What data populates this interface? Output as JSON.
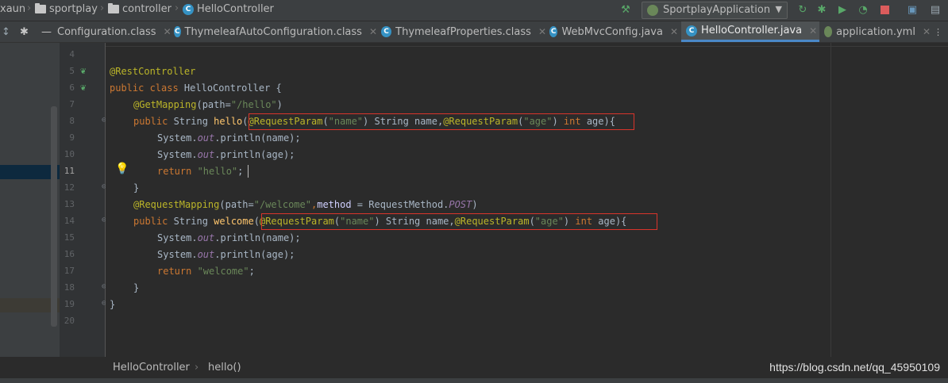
{
  "breadcrumb": {
    "items": [
      "xaun",
      "sportplay",
      "controller",
      "HelloController"
    ]
  },
  "toolbar": {
    "run_config": "SportplayApplication"
  },
  "tabs": [
    {
      "label": "Configuration.class"
    },
    {
      "label": "ThymeleafAutoConfiguration.class"
    },
    {
      "label": "ThymeleafProperties.class"
    },
    {
      "label": "WebMvcConfig.java"
    },
    {
      "label": "HelloController.java"
    },
    {
      "label": "application.yml"
    }
  ],
  "editor": {
    "line_numbers": [
      "4",
      "5",
      "6",
      "7",
      "8",
      "9",
      "10",
      "11",
      "12",
      "13",
      "14",
      "15",
      "16",
      "17",
      "18",
      "19",
      "20"
    ],
    "code": {
      "l5": "@RestController",
      "l6a": "public class ",
      "l6b": "HelloController {",
      "l7a": "@GetMapping",
      "l7b": "(path=",
      "l7c": "\"/hello\"",
      "l7d": ")",
      "l8a": "public ",
      "l8b": "String ",
      "l8c": "hello",
      "l8d": "(",
      "l8e": "@RequestParam",
      "l8f": "(",
      "l8g": "\"name\"",
      "l8h": ") String name,",
      "l8i": "@RequestParam",
      "l8j": "(",
      "l8k": "\"age\"",
      "l8l": ") ",
      "l8m": "int ",
      "l8n": "age){",
      "l9a": "System.",
      "l9b": "out",
      "l9c": ".println(name);",
      "l10a": "System.",
      "l10b": "out",
      "l10c": ".println(age);",
      "l11a": "return ",
      "l11b": "\"hello\"",
      "l11c": ";",
      "l12": "}",
      "l13a": "@RequestMapping",
      "l13b": "(path=",
      "l13c": "\"/welcome\"",
      "l13d": ",",
      "l13e": "method",
      "l13f": " = RequestMethod.",
      "l13g": "POST",
      "l13h": ")",
      "l14a": "public ",
      "l14b": "String ",
      "l14c": "welcome",
      "l14d": "(",
      "l14e": "@RequestParam",
      "l14f": "(",
      "l14g": "\"name\"",
      "l14h": ") String name,",
      "l14i": "@RequestParam",
      "l14j": "(",
      "l14k": "\"age\"",
      "l14l": ") ",
      "l14m": "int ",
      "l14n": "age){",
      "l15a": "System.",
      "l15b": "out",
      "l15c": ".println(name);",
      "l16a": "System.",
      "l16b": "out",
      "l16c": ".println(age);",
      "l17a": "return ",
      "l17b": "\"welcome\"",
      "l17c": ";",
      "l18": "}",
      "l19": "}"
    }
  },
  "status": {
    "crumb_class": "HelloController",
    "crumb_method": "hello()",
    "watermark": "https://blog.csdn.net/qq_45950109"
  },
  "colors": {
    "accent": "#4a88c7",
    "highlight_box": "#d9342b"
  }
}
